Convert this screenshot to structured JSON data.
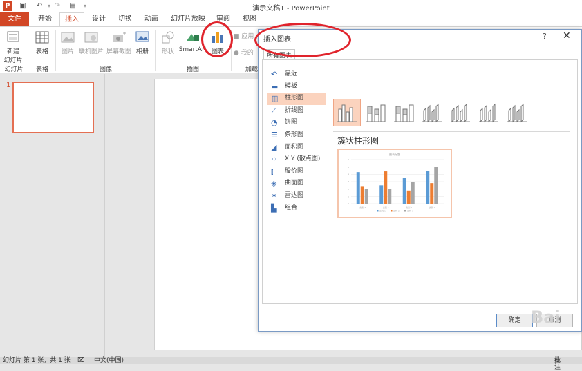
{
  "app": {
    "title": "演示文稿1 - PowerPoint"
  },
  "quick_access": [
    "save-icon",
    "undo-icon",
    "redo-icon",
    "slideshow-icon"
  ],
  "tabs": [
    "文件",
    "开始",
    "插入",
    "设计",
    "切换",
    "动画",
    "幻灯片放映",
    "审阅",
    "视图"
  ],
  "active_tab": "插入",
  "ribbon": {
    "buttons": {
      "new_slide": "新建",
      "new_slide_2": "幻灯片",
      "table": "表格",
      "picture": "图片",
      "online_picture": "联机图片",
      "screenshot": "屏幕截图",
      "album": "相册",
      "shapes": "形状",
      "smartart": "SmartArt",
      "chart": "图表",
      "store": "应用",
      "my_apps": "我的"
    },
    "groups": {
      "slides": "幻灯片",
      "tables": "表格",
      "images": "图像",
      "illustrations": "插图",
      "addins": "加载"
    }
  },
  "slides_panel": {
    "slide_number": "1"
  },
  "status": {
    "slide_info": "幻灯片 第 1 张，共 1 张",
    "language": "中文(中国)",
    "comments": "批注"
  },
  "dialog": {
    "title": "插入图表",
    "help": "?",
    "close": "✕",
    "tab": "所有图表",
    "chart_types": [
      {
        "label": "最近",
        "icon": "recent-icon"
      },
      {
        "label": "模板",
        "icon": "folder-icon"
      },
      {
        "label": "柱形图",
        "icon": "column-chart-icon"
      },
      {
        "label": "折线图",
        "icon": "line-chart-icon"
      },
      {
        "label": "饼图",
        "icon": "pie-chart-icon"
      },
      {
        "label": "条形图",
        "icon": "bar-chart-icon"
      },
      {
        "label": "面积图",
        "icon": "area-chart-icon"
      },
      {
        "label": "X Y (散点图)",
        "icon": "scatter-chart-icon"
      },
      {
        "label": "股价图",
        "icon": "stock-chart-icon"
      },
      {
        "label": "曲面图",
        "icon": "surface-chart-icon"
      },
      {
        "label": "雷达图",
        "icon": "radar-chart-icon"
      },
      {
        "label": "组合",
        "icon": "combo-chart-icon"
      }
    ],
    "selected_type": "柱形图",
    "subtype_count": 7,
    "subtype_name": "簇状柱形图",
    "ok": "确定",
    "cancel": "取消"
  },
  "preview_chart": {
    "title": "图表标题",
    "categories": [
      "类别 1",
      "类别 2",
      "类别 3",
      "类别 4"
    ],
    "series": [
      {
        "name": "系列 1",
        "color": "#5b9bd5",
        "values": [
          4.3,
          2.5,
          3.5,
          4.5
        ]
      },
      {
        "name": "系列 2",
        "color": "#ed7d31",
        "values": [
          2.4,
          4.4,
          1.8,
          2.8
        ]
      },
      {
        "name": "系列 3",
        "color": "#a5a5a5",
        "values": [
          2.0,
          2.0,
          3.0,
          5.0
        ]
      }
    ],
    "ymax": 6
  },
  "colors": {
    "accent": "#d24726",
    "annotation": "#e0242c",
    "selected": "#fbd3be"
  },
  "watermark": "Bai"
}
